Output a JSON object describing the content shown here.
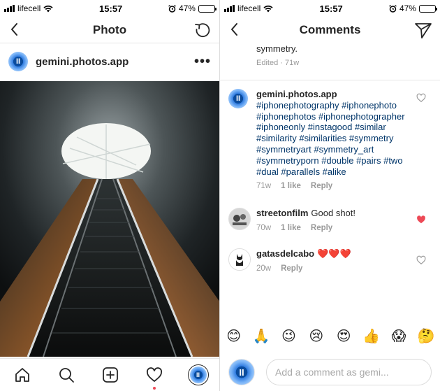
{
  "status_bar": {
    "carrier": "lifecell",
    "time": "15:57",
    "battery": "47%",
    "battery_level": 0.47
  },
  "photo_screen": {
    "title": "Photo",
    "username": "gemini.photos.app",
    "avatar_glyph": "II",
    "more_label": "•••",
    "tabs": [
      "home-icon",
      "search-icon",
      "new-post-icon",
      "activity-heart-icon",
      "profile-icon"
    ],
    "activity_dot_color": "#ed4956"
  },
  "comments_screen": {
    "title": "Comments",
    "prev_comment_tail": "symmetry.",
    "prev_comment_meta": "Edited · 71w",
    "comments": [
      {
        "username": "gemini.photos.app",
        "text": "#iphonephotography #iphonephoto #iphonephotos #iphonephotographer #iphoneonly #instagood #similar #similarity #similarities #symmetry #symmetryart #symmetry_art #symmetryporn #double #pairs #two #dual #parallels #alike",
        "age": "71w",
        "likes": "1 like",
        "reply": "Reply",
        "liked": false
      },
      {
        "username": "streetonfilm",
        "text": "Good shot!",
        "age": "70w",
        "likes": "1 like",
        "reply": "Reply",
        "liked": true
      },
      {
        "username": "gatasdelcabo",
        "text": "❤️❤️❤️",
        "age": "20w",
        "likes": "",
        "reply": "Reply",
        "liked": false
      }
    ],
    "emoji_bar": [
      "😊",
      "🙏",
      "😉",
      "😢",
      "😍",
      "👍",
      "😱",
      "🤔"
    ],
    "input_placeholder": "Add a comment as gemi...",
    "input_avatar_glyph": "II",
    "liked_color": "#ed4956",
    "hashtag_color": "#003569"
  }
}
